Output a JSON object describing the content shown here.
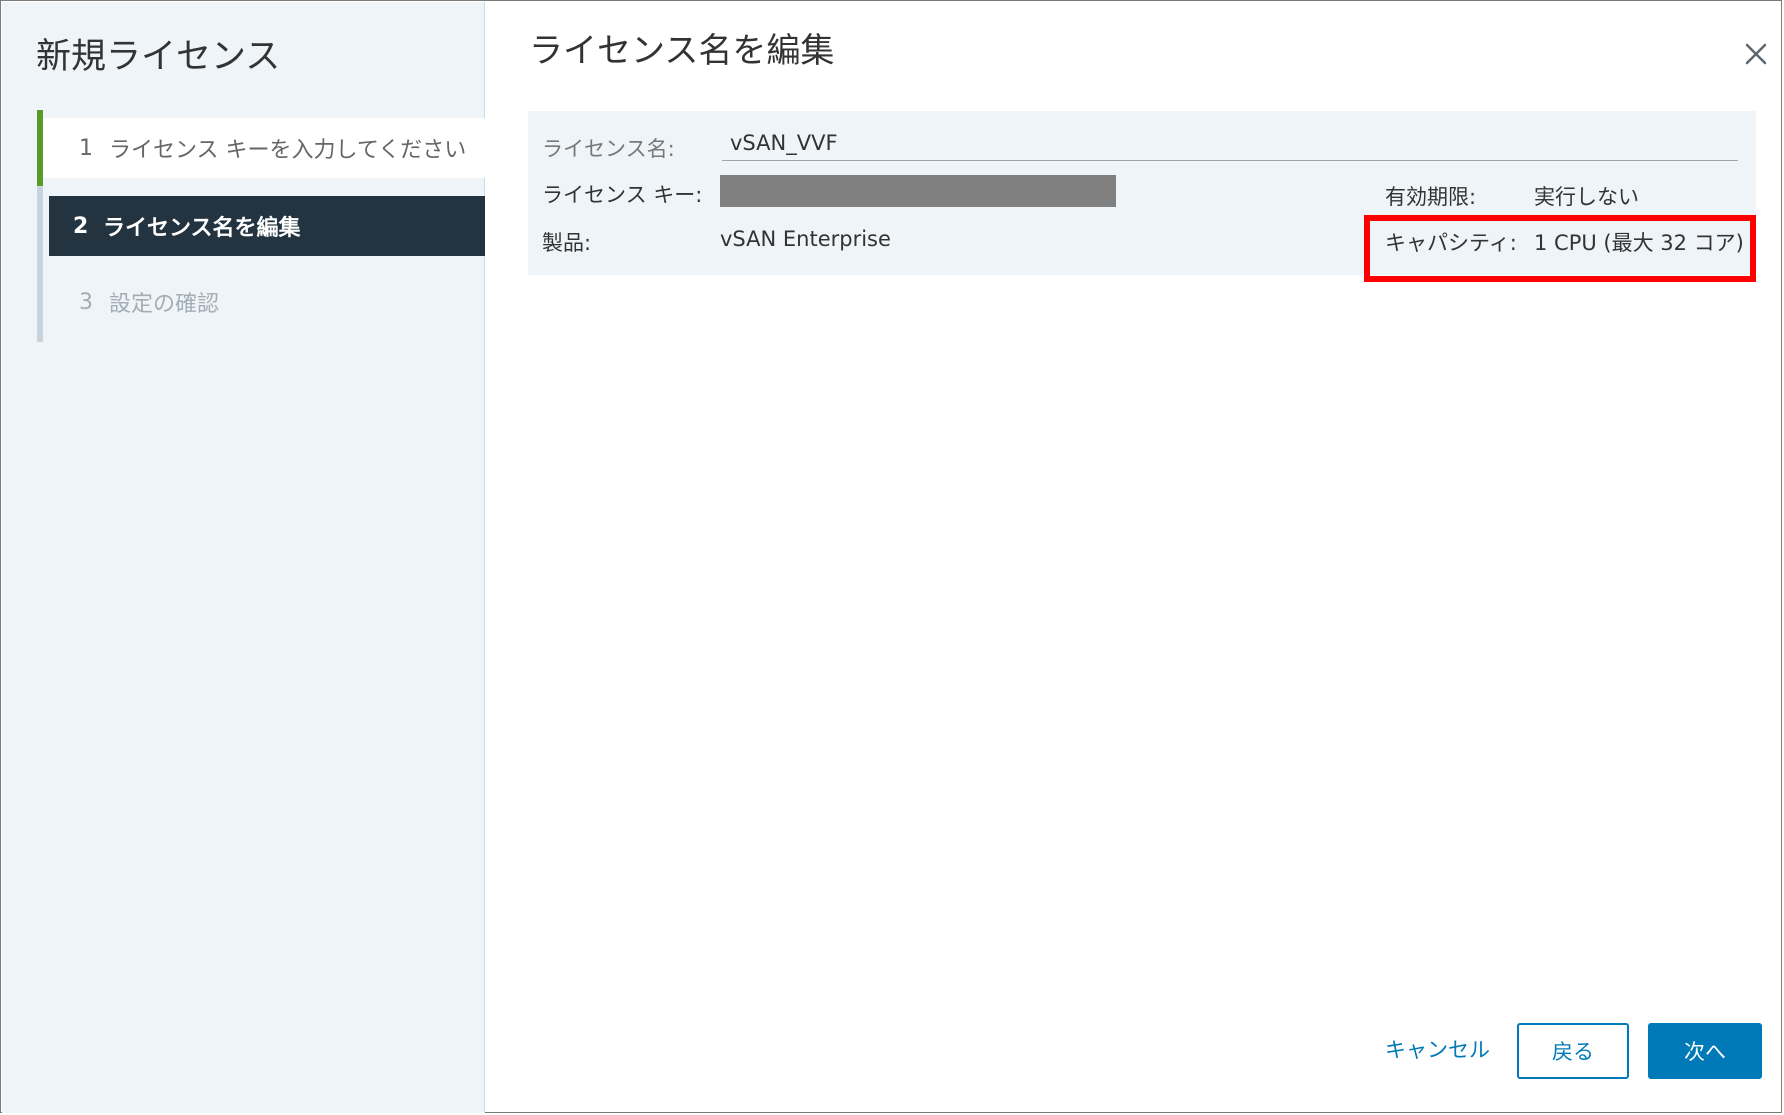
{
  "sidebar": {
    "title": "新規ライセンス",
    "steps": [
      {
        "number": "1",
        "label": "ライセンス キーを入力してください",
        "state": "completed"
      },
      {
        "number": "2",
        "label": "ライセンス名を編集",
        "state": "active"
      },
      {
        "number": "3",
        "label": "設定の確認",
        "state": "disabled"
      }
    ]
  },
  "main": {
    "title": "ライセンス名を編集",
    "fields": {
      "name_label": "ライセンス名:",
      "name_value": "vSAN_VVF",
      "key_label": "ライセンス キー:",
      "product_label": "製品:",
      "product_value": "vSAN Enterprise",
      "expiration_label": "有効期限:",
      "expiration_value": "実行しない",
      "capacity_label": "キャパシティ:",
      "capacity_value": "1 CPU (最大 32 コア)"
    }
  },
  "footer": {
    "cancel_label": "キャンセル",
    "back_label": "戻る",
    "next_label": "次へ"
  },
  "colors": {
    "accent": "#0079b8",
    "progress": "#5a9a28",
    "active_step": "#233440",
    "highlight": "#ff0000"
  }
}
